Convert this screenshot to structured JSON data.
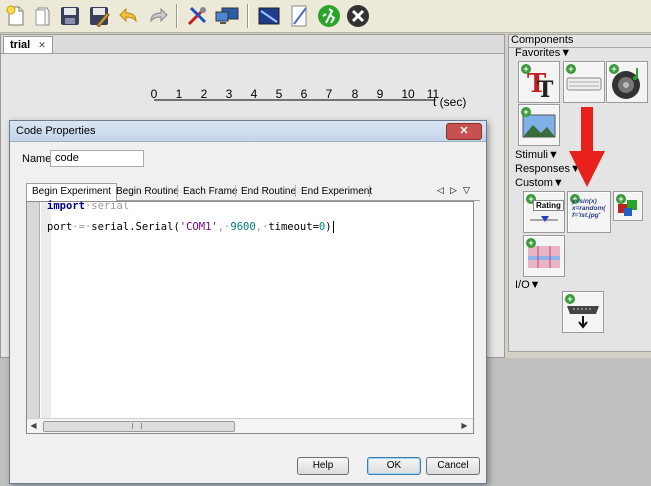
{
  "toolbar": {
    "icons": [
      "new-file-icon",
      "open-file-icon",
      "save-icon",
      "save-as-icon",
      "undo-icon",
      "redo-icon",
      "preferences-icon",
      "monitor-center-icon",
      "settings-icon",
      "compile-script-icon",
      "run-icon",
      "stop-icon"
    ]
  },
  "routine": {
    "tab_label": "trial",
    "tab_close": "✕",
    "timeline_ticks": [
      "0",
      "1",
      "2",
      "3",
      "4",
      "5",
      "6",
      "7",
      "8",
      "9",
      "10",
      "11"
    ],
    "timeline_unit": "t (sec)"
  },
  "components": {
    "title": "Components",
    "favorites": "Favorites▼",
    "stimuli": "Stimuli▼",
    "responses": "Responses▼",
    "custom": "Custom▼",
    "io": "I/O▼",
    "rating_label": "Rating",
    "code_icon_text": [
      "y=sin(x)",
      "x=random(",
      "f='ist.jpg'"
    ]
  },
  "dialog": {
    "title": "Code Properties",
    "close": "✕",
    "name_label": "Name",
    "name_value": "code",
    "tabs": [
      "Begin Experiment",
      "Begin Routine",
      "Each Frame",
      "End Routine",
      "End Experiment"
    ],
    "tab_nav": [
      "◁",
      "▷",
      "▽"
    ],
    "help_button": "Help",
    "ok_button": "OK",
    "cancel_button": "Cancel"
  },
  "code": {
    "line1_kw": "import",
    "line1_rest": "·serial",
    "line2": [
      {
        "t": "port",
        "c": ""
      },
      {
        "t": "·=·",
        "c": "ws"
      },
      {
        "t": "serial.Serial(",
        "c": ""
      },
      {
        "t": "'COM1'",
        "c": "str"
      },
      {
        "t": ",·",
        "c": "ws"
      },
      {
        "t": "9600",
        "c": "num"
      },
      {
        "t": ",·",
        "c": "ws"
      },
      {
        "t": "timeout=",
        "c": ""
      },
      {
        "t": "0",
        "c": "num"
      },
      {
        "t": ")",
        "c": ""
      }
    ]
  },
  "colors": {
    "arrow_red": "#e8201c",
    "run_green": "#2aa52a",
    "stop_dark": "#333333"
  }
}
